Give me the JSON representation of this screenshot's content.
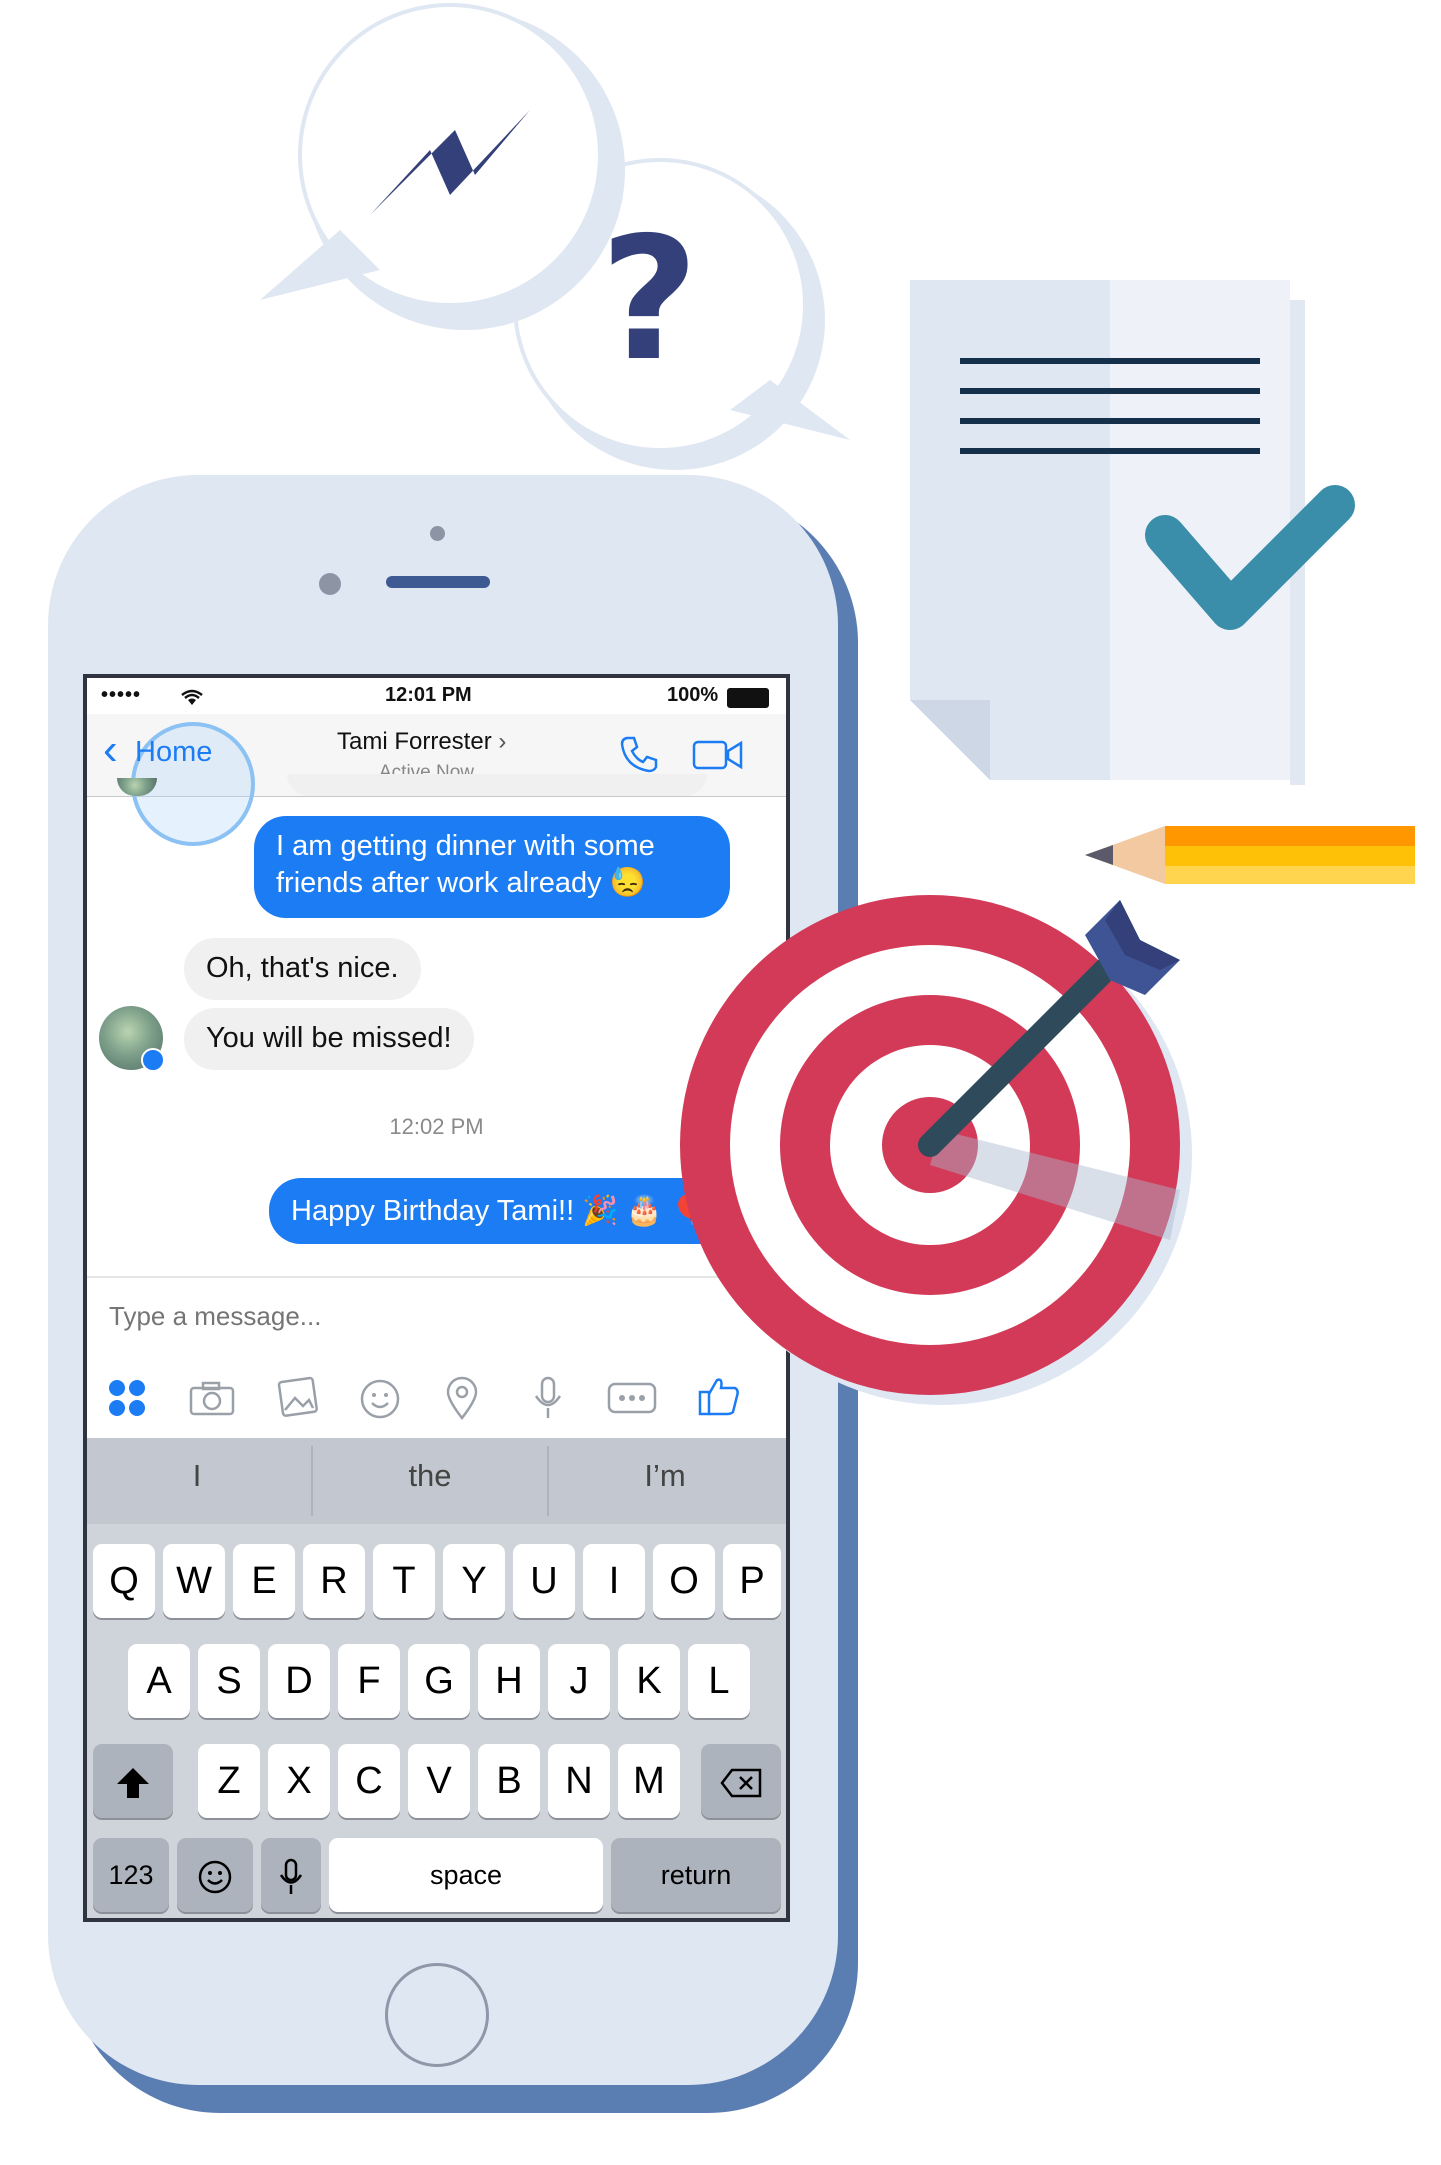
{
  "status_bar": {
    "signal": "•••••",
    "time": "12:01 PM",
    "battery": "100%"
  },
  "header": {
    "back_label": "Home",
    "contact_name": "Tami Forrester",
    "contact_chevron": "›",
    "contact_status": "Active Now",
    "call_icon": "phone-icon",
    "video_icon": "video-camera-icon"
  },
  "messages": {
    "out_1": [
      "I am getting dinner with some",
      "friends after work already 😓"
    ],
    "in_1": "Oh, that's nice.",
    "in_2": "You will be missed!",
    "timestamp": "12:02 PM",
    "out_2": "Happy Birthday Tami!! 🎉 🎂 🎈"
  },
  "composer": {
    "placeholder": "Type a message..."
  },
  "toolbar": [
    "apps-icon",
    "camera-icon",
    "gallery-icon",
    "emoji-icon",
    "location-icon",
    "microphone-icon",
    "more-icon",
    "thumbs-up-icon"
  ],
  "keyboard": {
    "suggestions": [
      "I",
      "the",
      "I’m"
    ],
    "row1": [
      "Q",
      "W",
      "E",
      "R",
      "T",
      "Y",
      "U",
      "I",
      "O",
      "P"
    ],
    "row2": [
      "A",
      "S",
      "D",
      "F",
      "G",
      "H",
      "J",
      "K",
      "L"
    ],
    "row3": [
      "Z",
      "X",
      "C",
      "V",
      "B",
      "N",
      "M"
    ],
    "numbers": "123",
    "space": "space",
    "return": "return"
  },
  "decor": {
    "question_mark": "?"
  },
  "colors": {
    "messenger_blue": "#1b7cf4",
    "navy": "#34407a",
    "target_red": "#d23a58",
    "check_teal": "#3b8ea9"
  }
}
